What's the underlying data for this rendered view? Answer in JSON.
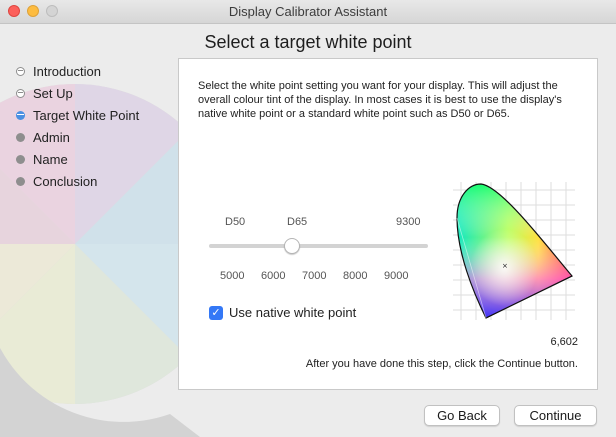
{
  "window": {
    "title": "Display Calibrator Assistant"
  },
  "page": {
    "title": "Select a target white point"
  },
  "steps": [
    {
      "label": "Introduction",
      "state": "done"
    },
    {
      "label": "Set Up",
      "state": "done"
    },
    {
      "label": "Target White Point",
      "state": "current"
    },
    {
      "label": "Admin",
      "state": "pending"
    },
    {
      "label": "Name",
      "state": "pending"
    },
    {
      "label": "Conclusion",
      "state": "pending"
    }
  ],
  "panel": {
    "description": "Select the white point setting you want for your display. This will adjust the overall colour tint of the display. In most cases it is best to use the display's native white point or a standard white point such as D50 or D65.",
    "top_labels": [
      "D50",
      "D65",
      "9300"
    ],
    "scale_labels": [
      "5000",
      "6000",
      "7000",
      "8000",
      "9000"
    ],
    "slider": {
      "min": 4500,
      "max": 9800,
      "value": 6500
    },
    "native_white_point": {
      "label": "Use native white point",
      "checked": true
    },
    "readout": "6,602",
    "instruction": "After you have done this step, click the Continue button."
  },
  "buttons": {
    "back": "Go Back",
    "continue": "Continue"
  },
  "colors": {
    "accent": "#3478f6",
    "current_step": "#4a90e2"
  }
}
